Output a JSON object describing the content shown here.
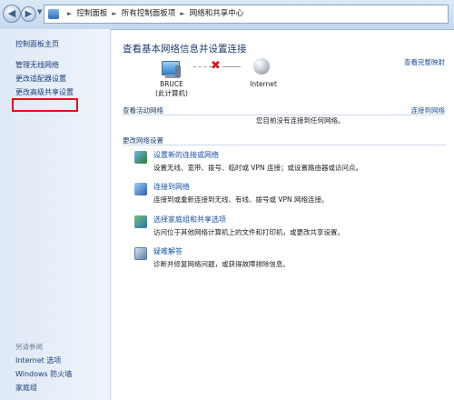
{
  "address": {
    "back_icon": "back-arrow-icon",
    "forward_icon": "forward-arrow-icon",
    "crumbs": [
      "控制面板",
      "所有控制面板项",
      "网络和共享中心"
    ]
  },
  "sidebar": {
    "home": "控制面板主页",
    "items": [
      "管理无线网络",
      "更改适配器设置",
      "更改高级共享设置"
    ],
    "see_also_heading": "另请参阅",
    "see_also": [
      "Internet 选项",
      "Windows 防火墙",
      "家庭组"
    ],
    "highlight_color": "#e0141b"
  },
  "main": {
    "heading": "查看基本网络信息并设置连接",
    "full_map_link": "查看完整映射",
    "computer_name": "BRUCE",
    "computer_sub": "(此计算机)",
    "internet_label": "Internet",
    "active_networks_label": "查看活动网络",
    "connect_link": "连接到网络",
    "no_connection_text": "您目前没有连接到任何网络。",
    "change_settings_label": "更改网络设置",
    "tasks": [
      {
        "icon": "network-setup-icon",
        "title": "设置新的连接或网络",
        "desc": "设置无线、宽带、拨号、临时或 VPN 连接；或设置路由器或访问点。"
      },
      {
        "icon": "connect-network-icon",
        "title": "连接到网络",
        "desc": "连接到或重新连接到无线、有线、拨号或 VPN 网络连接。"
      },
      {
        "icon": "homegroup-sharing-icon",
        "title": "选择家庭组和共享选项",
        "desc": "访问位于其他网络计算机上的文件和打印机，或更改共享设置。"
      },
      {
        "icon": "troubleshoot-icon",
        "title": "疑难解答",
        "desc": "诊断并修复网络问题，或获得故障排除信息。"
      }
    ]
  }
}
